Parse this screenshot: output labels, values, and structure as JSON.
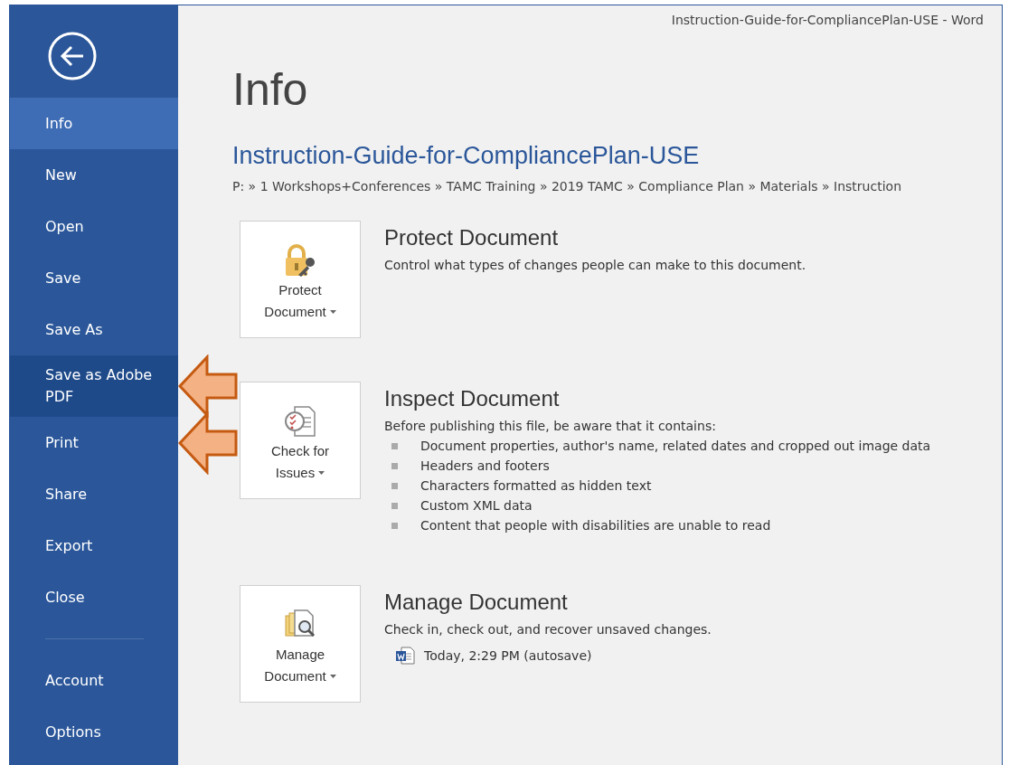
{
  "window": {
    "title": "Instruction-Guide-for-CompliancePlan-USE - Word"
  },
  "sidebar": {
    "items": [
      {
        "label": "Info",
        "selected": true,
        "highlighted": false,
        "marked_by_arrow": false
      },
      {
        "label": "New",
        "selected": false,
        "highlighted": false,
        "marked_by_arrow": false
      },
      {
        "label": "Open",
        "selected": false,
        "highlighted": false,
        "marked_by_arrow": false
      },
      {
        "label": "Save",
        "selected": false,
        "highlighted": false,
        "marked_by_arrow": false
      },
      {
        "label": "Save As",
        "selected": false,
        "highlighted": false,
        "marked_by_arrow": false
      },
      {
        "label": "Save as Adobe PDF",
        "selected": false,
        "highlighted": true,
        "marked_by_arrow": true
      },
      {
        "label": "Print",
        "selected": false,
        "highlighted": false,
        "marked_by_arrow": true
      },
      {
        "label": "Share",
        "selected": false,
        "highlighted": false,
        "marked_by_arrow": false
      },
      {
        "label": "Export",
        "selected": false,
        "highlighted": false,
        "marked_by_arrow": false
      },
      {
        "label": "Close",
        "selected": false,
        "highlighted": false,
        "marked_by_arrow": false
      }
    ],
    "bottom_items": [
      {
        "label": "Account",
        "selected": false,
        "highlighted": false,
        "marked_by_arrow": false
      },
      {
        "label": "Options",
        "selected": false,
        "highlighted": false,
        "marked_by_arrow": false
      }
    ]
  },
  "page": {
    "heading": "Info",
    "document_name": "Instruction-Guide-for-CompliancePlan-USE",
    "path": "P: » 1 Workshops+Conferences » TAMC Training » 2019 TAMC » Compliance Plan » Materials » Instruction"
  },
  "sections": [
    {
      "kind": "protect",
      "button": {
        "line1": "Protect",
        "line2": "Document"
      },
      "title": "Protect Document",
      "description": "Control what types of changes people can make to this document."
    },
    {
      "kind": "inspect",
      "button": {
        "line1": "Check for",
        "line2": "Issues"
      },
      "title": "Inspect Document",
      "description": "Before publishing this file, be aware that it contains:",
      "bullets": [
        "Document properties, author's name, related dates and cropped out image data",
        "Headers and footers",
        "Characters formatted as hidden text",
        "Custom XML data",
        "Content that people with disabilities are unable to read"
      ]
    },
    {
      "kind": "manage",
      "button": {
        "line1": "Manage",
        "line2": "Document"
      },
      "title": "Manage Document",
      "description": "Check in, check out, and recover unsaved changes.",
      "versions": [
        "Today, 2:29 PM (autosave)"
      ]
    }
  ]
}
